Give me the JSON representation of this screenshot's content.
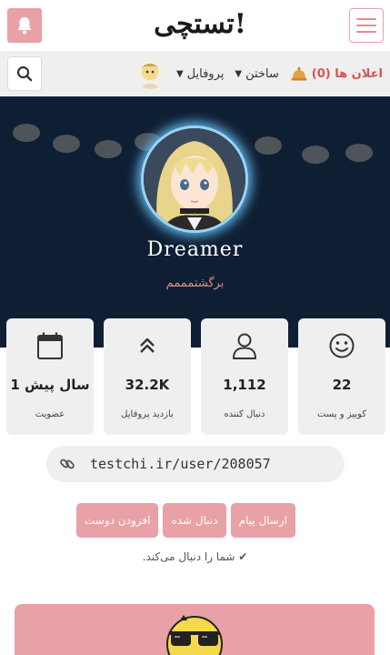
{
  "header": {
    "logo_text": "تستچی!",
    "bell_icon": "bell-icon",
    "menu_icon": "hamburger-icon"
  },
  "nav": {
    "profile_label": "پروفایل",
    "create_label": "ساختن",
    "alerts_label": "اعلان ها (0)",
    "search_icon": "search-icon"
  },
  "profile": {
    "username": "Dreamer",
    "bio": "برگشتمممم"
  },
  "stats": [
    {
      "value": "22",
      "label": "کوییز و پست",
      "icon": "smile-icon"
    },
    {
      "value": "1,112",
      "label": "دنبال کننده",
      "icon": "user-icon"
    },
    {
      "value": "32.2K",
      "label": "بازدید پروفایل",
      "icon": "chevrons-up-icon"
    },
    {
      "value": "1 سال پیش",
      "label": "عضویت",
      "icon": "calendar-icon"
    }
  ],
  "profile_url": "testchi.ir/user/208057",
  "actions": {
    "message": "ارسال پیام",
    "followed": "دنبال شده",
    "add_friend": "افزودن دوست"
  },
  "follow_note": "✔ شما را دنبال می‌کند.",
  "colors": {
    "accent": "#e8a1a6",
    "hero_bg": "#0f1f33",
    "card_bg": "#efefef",
    "alert": "#d9534f"
  }
}
